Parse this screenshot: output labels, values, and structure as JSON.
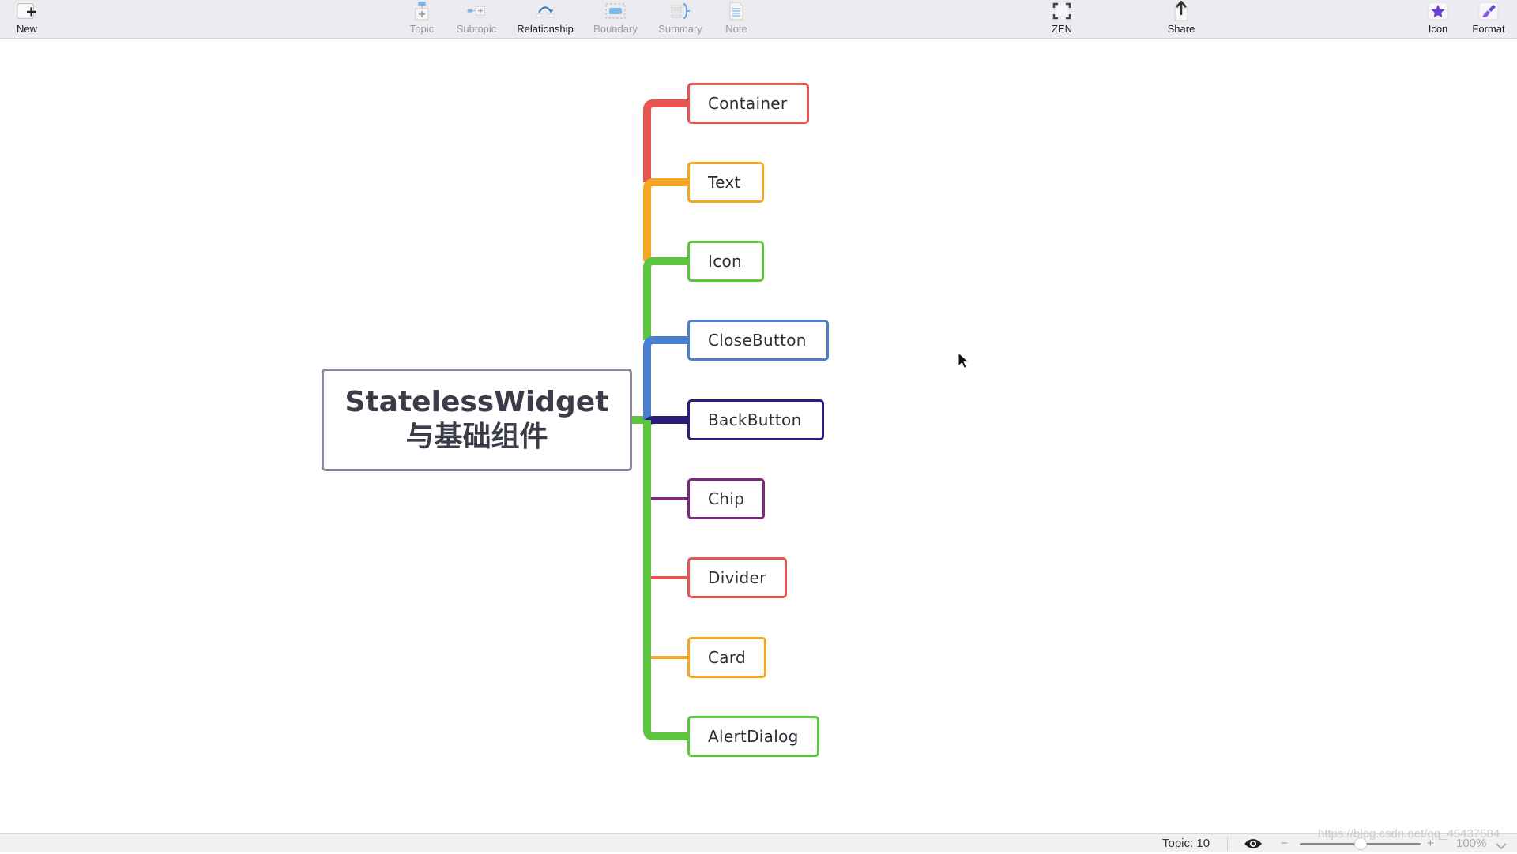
{
  "toolbar": {
    "new_label": "New",
    "topic_label": "Topic",
    "subtopic_label": "Subtopic",
    "relationship_label": "Relationship",
    "boundary_label": "Boundary",
    "summary_label": "Summary",
    "note_label": "Note",
    "zen_label": "ZEN",
    "share_label": "Share",
    "icon_label": "Icon",
    "format_label": "Format"
  },
  "mindmap": {
    "central_topic": {
      "line1": "StatelessWidget",
      "line2": "与基础组件",
      "border_color": "#858b9a"
    },
    "topics": [
      {
        "label": "Container",
        "color": "#e8544f"
      },
      {
        "label": "Text",
        "color": "#f5a623"
      },
      {
        "label": "Icon",
        "color": "#5bc53e"
      },
      {
        "label": "CloseButton",
        "color": "#4a7fd0"
      },
      {
        "label": "BackButton",
        "color": "#2a1e7a"
      },
      {
        "label": "Chip",
        "color": "#7b2a7e"
      },
      {
        "label": "Divider",
        "color": "#e8544f"
      },
      {
        "label": "Card",
        "color": "#f5a623"
      },
      {
        "label": "AlertDialog",
        "color": "#5bc53e"
      }
    ]
  },
  "statusbar": {
    "topic_count": "Topic: 10",
    "zoom_value": "100%",
    "zoom_minus": "−",
    "zoom_plus": "+",
    "zoom_slider_fraction": 0.5,
    "watermark": "https://blog.csdn.net/qq_45437584"
  },
  "icons": {
    "new": "new-icon",
    "topic": "topic-icon",
    "subtopic": "subtopic-icon",
    "relationship": "relationship-icon",
    "boundary": "boundary-icon",
    "summary": "summary-icon",
    "note": "note-icon",
    "zen": "zen-icon",
    "share": "share-icon",
    "icon": "star-icon",
    "format": "brush-icon",
    "eye": "eye-icon",
    "dropdown": "chevron-down-icon"
  },
  "colors": {
    "toolbar_bg": "#ecebef",
    "accent_purple": "#6b3fd6",
    "accent_blue": "#4aa3e0"
  }
}
